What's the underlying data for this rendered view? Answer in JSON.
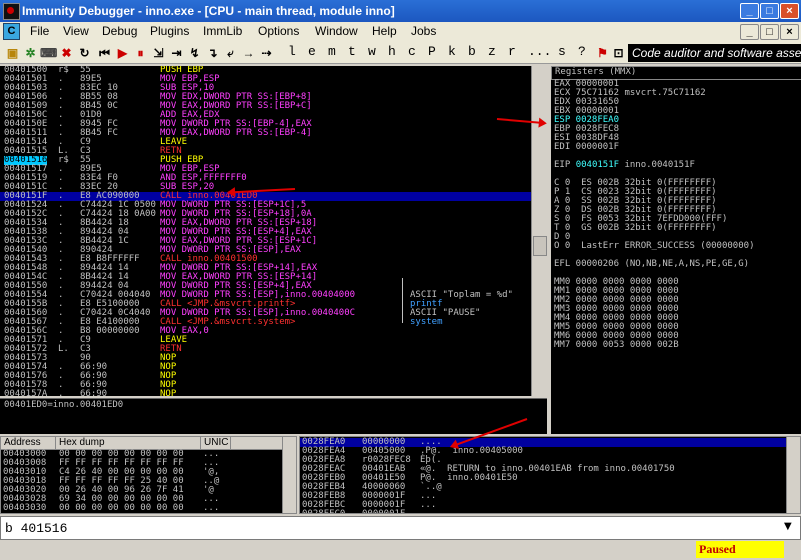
{
  "window": {
    "title": "Immunity Debugger - inno.exe - [CPU - main thread, module inno]",
    "minimize": "_",
    "maximize": "□",
    "close": "×"
  },
  "menu": {
    "items": [
      "File",
      "View",
      "Debug",
      "Plugins",
      "ImmLib",
      "Options",
      "Window",
      "Help",
      "Jobs"
    ],
    "c_icon": "C"
  },
  "toolbar": {
    "letters": [
      "l",
      "e",
      "m",
      "t",
      "w",
      "h",
      "c",
      "P",
      "k",
      "b",
      "z",
      "r",
      "...",
      "s",
      "?"
    ],
    "banner": "Code auditor and software assess"
  },
  "disasm": {
    "rows": [
      {
        "addr": "00401500",
        "mark": "r$",
        "hex": "55",
        "asm": "PUSH EBP",
        "c": "y"
      },
      {
        "addr": "00401501",
        "mark": ".",
        "hex": "89E5",
        "asm": "MOV EBP,ESP",
        "c": "m"
      },
      {
        "addr": "00401503",
        "mark": ".",
        "hex": "83EC 10",
        "asm": "SUB ESP,10",
        "c": "m"
      },
      {
        "addr": "00401506",
        "mark": ".",
        "hex": "8B55 08",
        "asm": "MOV EDX,DWORD PTR SS:[EBP+8]",
        "c": "m"
      },
      {
        "addr": "00401509",
        "mark": ".",
        "hex": "8B45 0C",
        "asm": "MOV EAX,DWORD PTR SS:[EBP+C]",
        "c": "m"
      },
      {
        "addr": "0040150C",
        "mark": ".",
        "hex": "01D0",
        "asm": "ADD EAX,EDX",
        "c": "m"
      },
      {
        "addr": "0040150E",
        "mark": ".",
        "hex": "8945 FC",
        "asm": "MOV DWORD PTR SS:[EBP-4],EAX",
        "c": "m"
      },
      {
        "addr": "00401511",
        "mark": ".",
        "hex": "8B45 FC",
        "asm": "MOV EAX,DWORD PTR SS:[EBP-4]",
        "c": "m"
      },
      {
        "addr": "00401514",
        "mark": ".",
        "hex": "C9",
        "asm": "LEAVE",
        "c": "y"
      },
      {
        "addr": "00401515",
        "mark": "L.",
        "hex": "C3",
        "asm": "RETN",
        "c": "r"
      },
      {
        "addr": "00401516",
        "mark": "r$",
        "hex": "55",
        "asm": "PUSH EBP",
        "c": "y",
        "eip": true
      },
      {
        "addr": "00401517",
        "mark": ".",
        "hex": "89E5",
        "asm": "MOV EBP,ESP",
        "c": "m"
      },
      {
        "addr": "00401519",
        "mark": ".",
        "hex": "83E4 F0",
        "asm": "AND ESP,FFFFFFF0",
        "c": "m"
      },
      {
        "addr": "0040151C",
        "mark": ".",
        "hex": "83EC 20",
        "asm": "SUB ESP,20",
        "c": "m"
      },
      {
        "addr": "0040151F",
        "mark": ".",
        "hex": "E8 AC090000",
        "asm": "CALL inno.00401ED0",
        "c": "r",
        "sel": true
      },
      {
        "addr": "00401524",
        "mark": ".",
        "hex": "C74424 1C 0500",
        "asm": "MOV DWORD PTR SS:[ESP+1C],5",
        "c": "m"
      },
      {
        "addr": "0040152C",
        "mark": ".",
        "hex": "C74424 18 0A00",
        "asm": "MOV DWORD PTR SS:[ESP+18],0A",
        "c": "m"
      },
      {
        "addr": "00401534",
        "mark": ".",
        "hex": "8B4424 18",
        "asm": "MOV EAX,DWORD PTR SS:[ESP+18]",
        "c": "m"
      },
      {
        "addr": "00401538",
        "mark": ".",
        "hex": "894424 04",
        "asm": "MOV DWORD PTR SS:[ESP+4],EAX",
        "c": "m"
      },
      {
        "addr": "0040153C",
        "mark": ".",
        "hex": "8B4424 1C",
        "asm": "MOV EAX,DWORD PTR SS:[ESP+1C]",
        "c": "m"
      },
      {
        "addr": "00401540",
        "mark": ".",
        "hex": "890424",
        "asm": "MOV DWORD PTR SS:[ESP],EAX",
        "c": "m"
      },
      {
        "addr": "00401543",
        "mark": ".",
        "hex": "E8 B8FFFFFF",
        "asm": "CALL inno.00401500",
        "c": "r"
      },
      {
        "addr": "00401548",
        "mark": ".",
        "hex": "894424 14",
        "asm": "MOV DWORD PTR SS:[ESP+14],EAX",
        "c": "m"
      },
      {
        "addr": "0040154C",
        "mark": ".",
        "hex": "8B4424 14",
        "asm": "MOV EAX,DWORD PTR SS:[ESP+14]",
        "c": "m"
      },
      {
        "addr": "00401550",
        "mark": ".",
        "hex": "894424 04",
        "asm": "MOV DWORD PTR SS:[ESP+4],EAX",
        "c": "m"
      },
      {
        "addr": "00401554",
        "mark": ".",
        "hex": "C70424 004040",
        "asm": "MOV DWORD PTR SS:[ESP],inno.00404000",
        "c": "m"
      },
      {
        "addr": "0040155B",
        "mark": ".",
        "hex": "E8 E5100000",
        "asm": "CALL <JMP.&msvcrt.printf>",
        "c": "r"
      },
      {
        "addr": "00401560",
        "mark": ".",
        "hex": "C70424 0C4040",
        "asm": "MOV DWORD PTR SS:[ESP],inno.0040400C",
        "c": "m"
      },
      {
        "addr": "00401567",
        "mark": ".",
        "hex": "E8 E4100000",
        "asm": "CALL <JMP.&msvcrt.system>",
        "c": "r"
      },
      {
        "addr": "0040156C",
        "mark": ".",
        "hex": "B8 00000000",
        "asm": "MOV EAX,0",
        "c": "m"
      },
      {
        "addr": "00401571",
        "mark": ".",
        "hex": "C9",
        "asm": "LEAVE",
        "c": "y"
      },
      {
        "addr": "00401572",
        "mark": "L.",
        "hex": "C3",
        "asm": "RETN",
        "c": "r"
      },
      {
        "addr": "00401573",
        "mark": "",
        "hex": "90",
        "asm": "NOP",
        "c": "y"
      },
      {
        "addr": "00401574",
        "mark": ".",
        "hex": "66:90",
        "asm": "NOP",
        "c": "y"
      },
      {
        "addr": "00401576",
        "mark": ".",
        "hex": "66:90",
        "asm": "NOP",
        "c": "y"
      },
      {
        "addr": "00401578",
        "mark": ".",
        "hex": "66:90",
        "asm": "NOP",
        "c": "y"
      },
      {
        "addr": "0040157A",
        "mark": ".",
        "hex": "66:90",
        "asm": "NOP",
        "c": "y"
      }
    ],
    "comments": [
      {
        "row": 25,
        "text": "ASCII \"Toplam = %d\""
      },
      {
        "row": 26,
        "text": "printf"
      },
      {
        "row": 27,
        "text": "ASCII \"PAUSE\""
      },
      {
        "row": 28,
        "text": "system"
      }
    ],
    "info": "00401ED0=inno.00401ED0"
  },
  "registers": {
    "header": "Registers (MMX)",
    "lines": [
      {
        "t": "EAX 00000001",
        "c": "w"
      },
      {
        "t": "ECX 75C71162 msvcrt.75C71162",
        "c": "w"
      },
      {
        "t": "EDX 00331650",
        "c": "w"
      },
      {
        "t": "EBX 00000001",
        "c": "w"
      },
      {
        "t": "ESP 0028FEA0",
        "c": "c"
      },
      {
        "t": "EBP 0028FEC8",
        "c": "w"
      },
      {
        "t": "ESI 0038DF48",
        "c": "w"
      },
      {
        "t": "EDI 0000001F",
        "c": "w"
      },
      {
        "t": "",
        "c": "w"
      },
      {
        "t": "EIP 0040151F inno.0040151F",
        "c": "eip"
      },
      {
        "t": "",
        "c": "w"
      },
      {
        "t": "C 0  ES 002B 32bit 0(FFFFFFFF)",
        "c": "w"
      },
      {
        "t": "P 1  CS 0023 32bit 0(FFFFFFFF)",
        "c": "w"
      },
      {
        "t": "A 0  SS 002B 32bit 0(FFFFFFFF)",
        "c": "w"
      },
      {
        "t": "Z 0  DS 002B 32bit 0(FFFFFFFF)",
        "c": "w"
      },
      {
        "t": "S 0  FS 0053 32bit 7EFDD000(FFF)",
        "c": "w"
      },
      {
        "t": "T 0  GS 002B 32bit 0(FFFFFFFF)",
        "c": "w"
      },
      {
        "t": "D 0",
        "c": "w"
      },
      {
        "t": "O 0  LastErr ERROR_SUCCESS (00000000)",
        "c": "w"
      },
      {
        "t": "",
        "c": "w"
      },
      {
        "t": "EFL 00000206 (NO,NB,NE,A,NS,PE,GE,G)",
        "c": "w"
      },
      {
        "t": "",
        "c": "w"
      },
      {
        "t": "MM0 0000 0000 0000 0000",
        "c": "w"
      },
      {
        "t": "MM1 0000 0000 0000 0000",
        "c": "w"
      },
      {
        "t": "MM2 0000 0000 0000 0000",
        "c": "w"
      },
      {
        "t": "MM3 0000 0000 0000 0000",
        "c": "w"
      },
      {
        "t": "MM4 0000 0000 0000 0000",
        "c": "w"
      },
      {
        "t": "MM5 0000 0000 0000 0000",
        "c": "w"
      },
      {
        "t": "MM6 0000 0000 0000 0000",
        "c": "w"
      },
      {
        "t": "MM7 0000 0053 0000 002B",
        "c": "w"
      }
    ]
  },
  "dump": {
    "headers": [
      "Address",
      "Hex dump",
      "UNIC"
    ],
    "rows": [
      [
        "00403000",
        "00 00 00 00 00 00 00 00",
        "..."
      ],
      [
        "00403008",
        "FF FF FF FF FF FF FF FF",
        "..."
      ],
      [
        "00403010",
        "C4 26 40 00 00 00 00 00",
        "'@,"
      ],
      [
        "00403018",
        "FF FF FF FF FF 25 40 00",
        "..@"
      ],
      [
        "00403020",
        "00 26 40 00 96 26 7F 41",
        "'@"
      ],
      [
        "00403028",
        "69 34 00 00 00 00 00 00",
        "..."
      ],
      [
        "00403030",
        "00 00 00 00 00 00 00 00",
        "..."
      ]
    ]
  },
  "stack": {
    "rows": [
      {
        "addr": "0028FEA0",
        "val": "00000000",
        "com": "....",
        "sel": true
      },
      {
        "addr": "0028FEA4",
        "val": "00405000",
        "com": ".P@.  inno.00405000"
      },
      {
        "addr": "0028FEA8",
        "val": "r0028FEC8",
        "com": "Èþ(."
      },
      {
        "addr": "0028FEAC",
        "val": "00401EAB",
        "com": "«\u001e@.  RETURN to inno.00401EAB from inno.00401750"
      },
      {
        "addr": "0028FEB0",
        "val": "00401E50",
        "com": "P\u001e@.  inno.00401E50"
      },
      {
        "addr": "0028FEB4",
        "val": "40000060",
        "com": "`..@"
      },
      {
        "addr": "0028FEB8",
        "val": "0000001F",
        "com": "\u0019..."
      },
      {
        "addr": "0028FEBC",
        "val": "0000001F",
        "com": "\u0019..."
      },
      {
        "addr": "0028FEC0",
        "val": "0000001F",
        "com": "\u0019..."
      }
    ]
  },
  "command": {
    "value": "b 401516"
  },
  "status": {
    "text": "Paused"
  }
}
